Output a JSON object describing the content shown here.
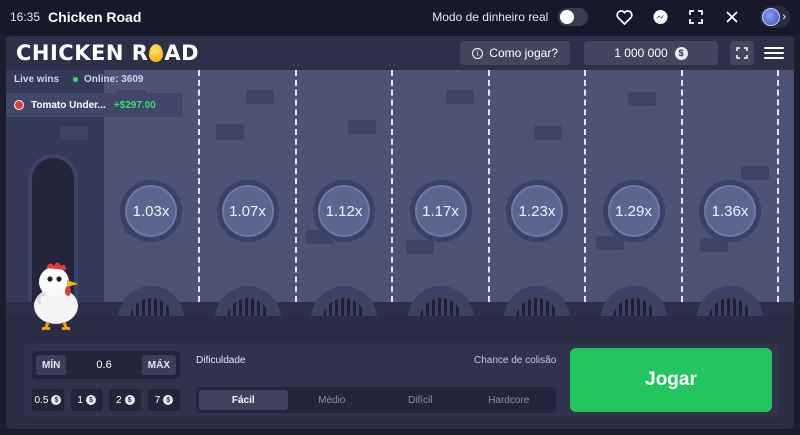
{
  "topbar": {
    "time": "16:35",
    "title": "Chicken Road",
    "mode_label": "Modo de dinheiro real",
    "icons": [
      "heart-icon",
      "messenger-icon",
      "fullscreen-icon",
      "close-icon"
    ]
  },
  "header": {
    "logo_left": "CHICKEN R",
    "logo_right": "AD",
    "how_to_play": "Como jogar?",
    "balance": "1 000 000",
    "currency_symbol": "$"
  },
  "live": {
    "label": "Live wins",
    "online": "Online: 3609",
    "latest_player": "Tomato Under...",
    "latest_amount": "+$297.00"
  },
  "multipliers": [
    "1.03x",
    "1.07x",
    "1.12x",
    "1.17x",
    "1.23x",
    "1.29x",
    "1.36x"
  ],
  "controls": {
    "min_label": "MÍN",
    "max_label": "MÁX",
    "bet_value": "0.6",
    "quick_bets": [
      "0.5",
      "1",
      "2",
      "7"
    ],
    "difficulty_label": "Dificuldade",
    "chance_label": "Chance de colisão",
    "difficulties": [
      "Fácil",
      "Médio",
      "Difícil",
      "Hardcore"
    ],
    "active_difficulty": "Fácil",
    "play_label": "Jogar"
  },
  "colors": {
    "accent_green": "#22c55e",
    "field": "#4c5377"
  }
}
